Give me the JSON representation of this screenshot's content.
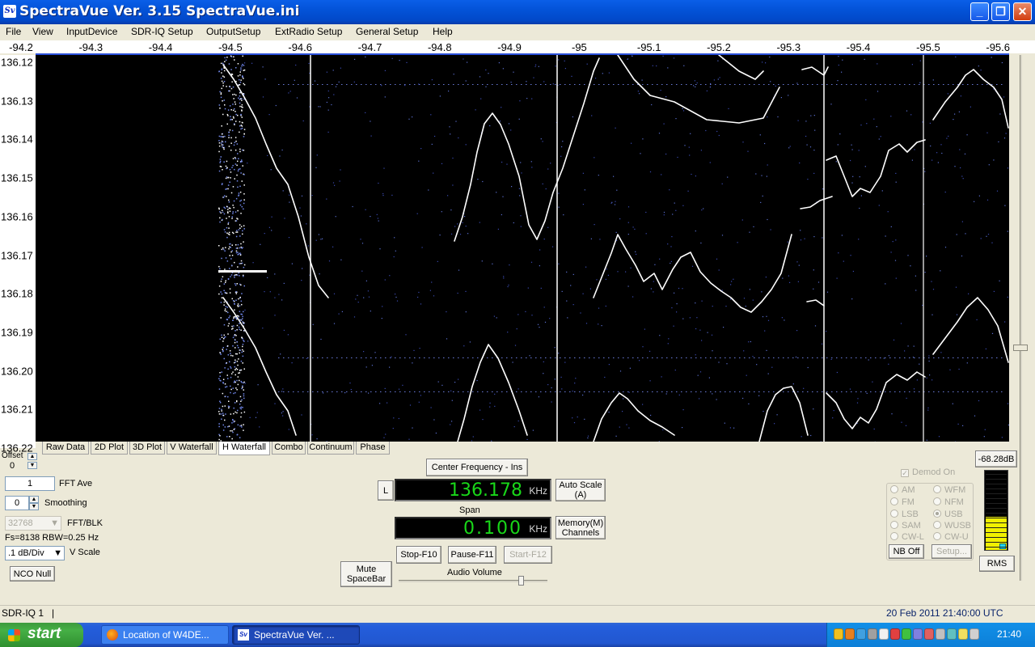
{
  "window": {
    "title": "SpectraVue Ver. 3.15  SpectraVue.ini",
    "app_icon": "Sv",
    "minimize_glyph": "_",
    "maximize_glyph": "❐",
    "close_glyph": "✕"
  },
  "menu": [
    "File",
    "View",
    "InputDevice",
    "SDR-IQ Setup",
    "OutputSetup",
    "ExtRadio Setup",
    "General Setup",
    "Help"
  ],
  "freq_axis": {
    "ticks": [
      "-94.2",
      "-94.3",
      "-94.4",
      "-94.5",
      "-94.6",
      "-94.7",
      "-94.8",
      "-94.9",
      "-95",
      "-95.1",
      "-95.2",
      "-95.3",
      "-95.4",
      "-95.5",
      "-95.6"
    ]
  },
  "time_axis": {
    "ticks": [
      "136.12",
      "136.13",
      "136.14",
      "136.15",
      "136.16",
      "136.17",
      "136.18",
      "136.19",
      "136.20",
      "136.21",
      "136.22"
    ]
  },
  "tabs": [
    "Raw Data",
    "2D Plot",
    "3D Plot",
    "V Waterfall",
    "H Waterfall",
    "Combo",
    "Continuum",
    "Phase"
  ],
  "active_tab": "H Waterfall",
  "left_controls": {
    "offset_label": "Offset",
    "offset_value": "0",
    "fft_ave_value": "1",
    "fft_ave_label": "FFT Ave",
    "smoothing_value": "0",
    "smoothing_label": "Smoothing",
    "fft_blk_value": "32768",
    "fft_blk_label": "FFT/BLK",
    "fs_info": "Fs=8138 RBW=0.25 Hz",
    "vscale_value": ".1 dB/Div",
    "vscale_label": "V Scale",
    "nco_null": "NCO Null"
  },
  "center": {
    "center_freq_button": "Center Frequency - Ins",
    "l_button": "L",
    "freq_value": "136.178",
    "freq_unit": "KHz",
    "auto_scale": "Auto Scale (A)",
    "span_label": "Span",
    "span_value": "0.100",
    "span_unit": "KHz",
    "memory": "Memory(M) Channels",
    "mute": "Mute SpaceBar",
    "stop": "Stop-F10",
    "pause": "Pause-F11",
    "start": "Start-F12",
    "audio_volume": "Audio Volume",
    "audio_volume_level": 0.82
  },
  "demod": {
    "demod_on": "Demod On",
    "modes_left": [
      "AM",
      "FM",
      "LSB",
      "SAM",
      "CW-L"
    ],
    "modes_right": [
      "WFM",
      "NFM",
      "USB",
      "WUSB",
      "CW-U"
    ],
    "selected": "USB",
    "nb_off": "NB Off",
    "setup": "Setup..."
  },
  "meter": {
    "level_readout": "-68.28dB",
    "rms": "RMS",
    "fill_fraction": 0.42
  },
  "status": {
    "device": "SDR-IQ 1",
    "separator": "|",
    "datetime": "20 Feb 2011   21:40:00 UTC"
  },
  "taskbar": {
    "start": "start",
    "tasks": [
      "Location of W4DE...",
      "SpectraVue Ver. ..."
    ],
    "clock": "21:40"
  },
  "colors": {
    "titlebar": "#0353d8",
    "waterfall_bg": "#000000",
    "trace": "#ffffff",
    "display_digits": "#19d819",
    "meter_fill": "#f0f000",
    "taskbar": "#245edc",
    "start_button": "#3c9a3c"
  }
}
